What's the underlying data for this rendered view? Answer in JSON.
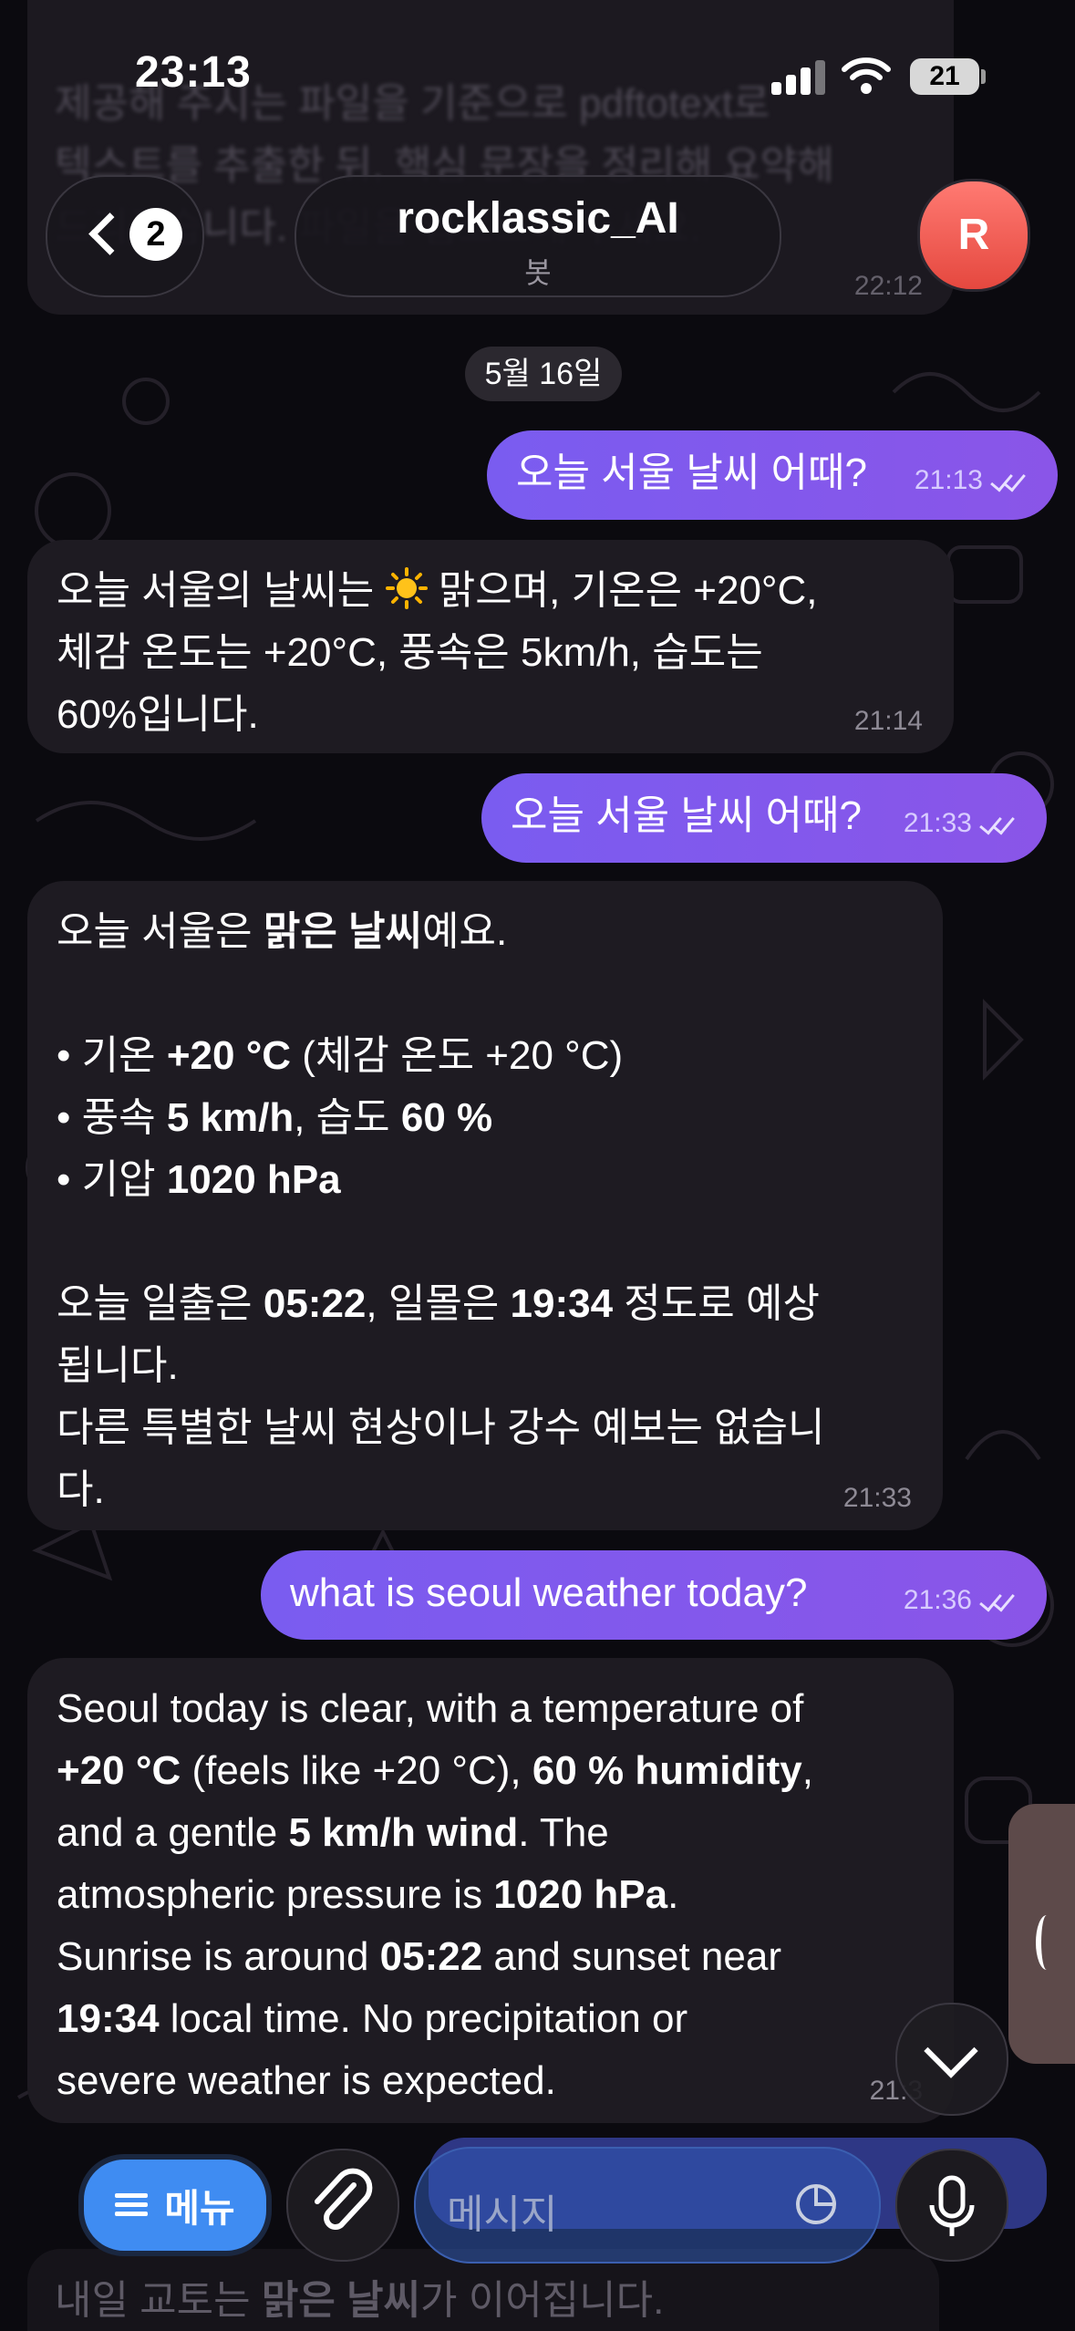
{
  "status_bar": {
    "time": "23:13",
    "battery": "21"
  },
  "prev_message": {
    "lines": [
      "제공해 주시는 파일을 기준으로 pdftotext로",
      "텍스트를 추출한 뒤, 핵심 문장을 정리해 요약해",
      "드리겠습니다. 파일을 업로드해 주세요."
    ],
    "time": "22:12"
  },
  "header": {
    "back_count": "2",
    "title": "rocklassic_AI",
    "subtitle": "봇",
    "avatar_initial": "R"
  },
  "date_chip": "5월 16일",
  "messages": {
    "out1": {
      "text": "오늘 서울 날씨 어때?",
      "time": "21:13"
    },
    "in1": {
      "l1a": "오늘 서울의 날씨는 ",
      "l1b": " 맑으며, 기온은 +20°C,",
      "l2": "체감 온도는 +20°C, 풍속은 5km/h, 습도는",
      "l3": "60%입니다.",
      "time": "21:14"
    },
    "out2": {
      "text": "오늘 서울 날씨 어때?",
      "time": "21:33"
    },
    "in2": {
      "l1a": "오늘 서울은 ",
      "l1b": "맑은 날씨",
      "l1c": "예요.",
      "b1a": "• 기온 ",
      "b1b": "+20 °C",
      "b1c": " (체감 온도 +20 °C)",
      "b2a": "• 풍속 ",
      "b2b": "5 km/h",
      "b2c": ", 습도 ",
      "b2d": "60 %",
      "b3a": "• 기압 ",
      "b3b": "1020 hPa",
      "s1a": "오늘 일출은 ",
      "s1b": "05:22",
      "s1c": ", 일몰은 ",
      "s1d": "19:34",
      "s1e": " 정도로 예상",
      "s2": "됩니다.",
      "s3": "다른 특별한 날씨 현상이나 강수 예보는 없습니",
      "s4": "다.",
      "time": "21:33"
    },
    "out3": {
      "text": "what is seoul weather today?",
      "time": "21:36"
    },
    "in3": {
      "l1": "Seoul today is clear, with a temperature of",
      "l2a": "+20 °C",
      "l2b": " (feels like +20 °C), ",
      "l2c": "60 % humidity",
      "l2d": ",",
      "l3a": "and a gentle ",
      "l3b": "5 km/h wind",
      "l3c": ". The",
      "l4a": "atmospheric pressure is ",
      "l4b": "1020 hPa",
      "l4c": ".",
      "l5a": "Sunrise is around ",
      "l5b": "05:22",
      "l5c": " and sunset near",
      "l6a": "19:34",
      "l6b": " local time. No precipitation or",
      "l7": "severe weather is expected.",
      "time": "21:3"
    }
  },
  "bottom": {
    "menu_label": "메뉴",
    "input_placeholder": "메시지",
    "faded_a": "내일 교토는 ",
    "faded_b": "맑은 날씨",
    "faded_c": "가 이어집니다."
  },
  "colors": {
    "outgoing": "#7a5cf0",
    "incoming": "#1e1b22",
    "menu": "#3f8cf2",
    "avatar": "#ee5a50"
  }
}
